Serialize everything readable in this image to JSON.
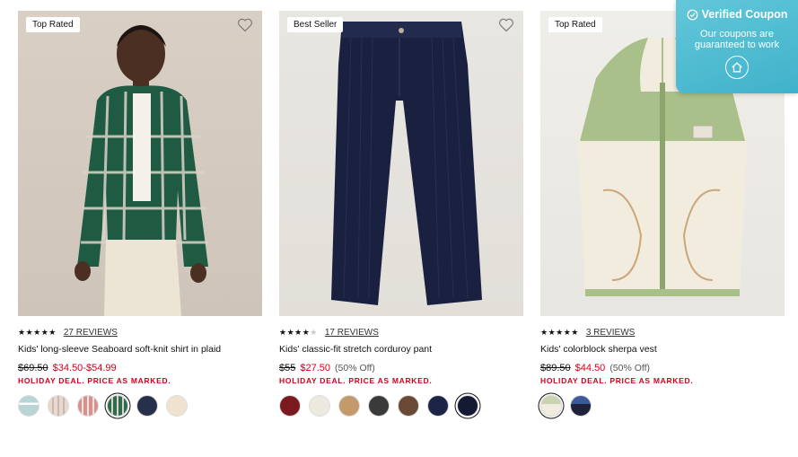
{
  "products": [
    {
      "badge": "Top Rated",
      "stars_text": "★★★★★",
      "stars_dim": "",
      "rating": 5,
      "reviews": "27 REVIEWS",
      "name": "Kids' long-sleeve Seaboard soft-knit shirt in plaid",
      "was": "$69.50",
      "now": "$34.50-$54.99",
      "off": "",
      "deal": "HOLIDAY DEAL. PRICE AS MARKED.",
      "swatches": [
        "#b9d4d4",
        "#e8d8d0",
        "#d98f8c",
        "#2f6b4f",
        "#27304a",
        "#efe3cf"
      ],
      "selected_swatch": 3
    },
    {
      "badge": "Best Seller",
      "stars_text": "★★★★",
      "stars_dim": "★",
      "rating": 4,
      "reviews": "17 REVIEWS",
      "name": "Kids' classic-fit stretch corduroy pant",
      "was": "$55",
      "now": "$27.50",
      "off": "(50% Off)",
      "deal": "HOLIDAY DEAL. PRICE AS MARKED.",
      "swatches": [
        "#7a1a1f",
        "#ece9df",
        "#c49a6a",
        "#3a3a3a",
        "#6a4a36",
        "#1c2547",
        "#151a33"
      ],
      "selected_swatch": 6
    },
    {
      "badge": "Top Rated",
      "stars_text": "★★★★★",
      "stars_dim": "",
      "rating": 5,
      "reviews": "3 REVIEWS",
      "name": "Kids' colorblock sherpa vest",
      "was": "$89.50",
      "now": "$44.50",
      "off": "(50% Off)",
      "deal": "HOLIDAY DEAL. PRICE AS MARKED.",
      "swatches": [
        "#c9d3b0",
        "#1d2238"
      ],
      "selected_swatch": 0
    }
  ],
  "coupon": {
    "title": "Verified Coupon",
    "subtitle": "Our coupons are guaranteed to work"
  },
  "icons": {
    "wishlist": "heart-icon",
    "coupon_check": "check-circle-icon",
    "coupon_home": "home-icon"
  }
}
